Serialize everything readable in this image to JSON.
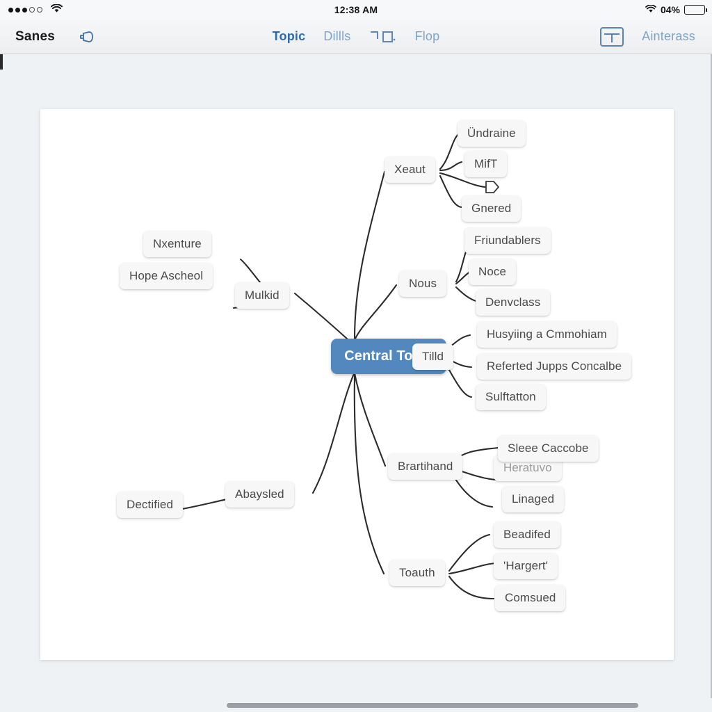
{
  "status_bar": {
    "signal_filled_dots": 3,
    "signal_hollow_dots": 2,
    "wifi_icon": "wifi-icon",
    "time": "12:38 AM",
    "battery_percent": "04%",
    "battery_icon": "battery-icon"
  },
  "toolbar": {
    "doc_title": "Sanes",
    "left_icon": "pen-tool-icon",
    "tabs": [
      {
        "label": "Topic",
        "active": true
      },
      {
        "label": "Dillls",
        "active": false
      },
      {
        "label": "",
        "active": false,
        "icon": "layout-bracket-icon"
      },
      {
        "label": "Flop",
        "active": false
      }
    ],
    "right_icon": "panel-layout-icon",
    "right_label": "Ainterass"
  },
  "mindmap": {
    "central": {
      "label": "Central Topic"
    },
    "branches": [
      {
        "label": "Xeaut",
        "children": [
          {
            "label": "Ündraine"
          },
          {
            "label": "MifT"
          },
          {
            "label": "",
            "icon": "cursor-arrow-icon"
          },
          {
            "label": "Gnered"
          }
        ]
      },
      {
        "label": "Nous",
        "children": [
          {
            "label": "Friundablers"
          },
          {
            "label": "Noce"
          },
          {
            "label": "Denvclass"
          }
        ]
      },
      {
        "label": "Tilld",
        "children": [
          {
            "label": "Husyiing a Cmmohiam"
          },
          {
            "label": "Referted Jupps Concalbe"
          },
          {
            "label": "Sulftatton"
          }
        ]
      },
      {
        "label": "Brartihand",
        "children": [
          {
            "label": "Sleee Caccobe"
          },
          {
            "label": "Heratuvo",
            "faded": true
          },
          {
            "label": "Linaged"
          }
        ]
      },
      {
        "label": "Toauth",
        "children": [
          {
            "label": "Beadifed"
          },
          {
            "label": "'Hargert'"
          },
          {
            "label": "Comsued"
          }
        ]
      },
      {
        "label": "Mulkid",
        "children": [
          {
            "label": "Nxenture"
          },
          {
            "label": "Hope Ascheol"
          }
        ]
      },
      {
        "label": "Abaysled",
        "children": [
          {
            "label": "Dectified"
          }
        ]
      }
    ]
  },
  "colors": {
    "central_node": "#5288bd",
    "tab_active": "#2d6bb0",
    "tab_inactive": "#7fa3c9",
    "canvas_bg": "#eef2f5",
    "page_bg": "#ffffff",
    "node_bg": "#f7f7f8"
  }
}
